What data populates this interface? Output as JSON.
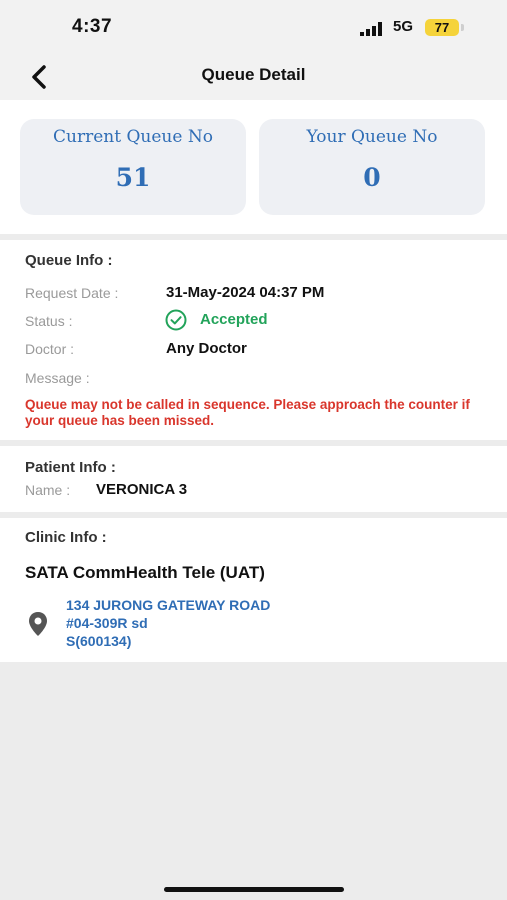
{
  "statusbar": {
    "time": "4:37",
    "network": "5G",
    "battery": "77"
  },
  "nav": {
    "title": "Queue Detail",
    "back_icon": "chevron-left-icon"
  },
  "queue": {
    "current_label": "Current Queue No",
    "current_value": "51",
    "yours_label": "Your Queue No",
    "yours_value": "0"
  },
  "queue_info": {
    "title": "Queue Info :",
    "request_date_label": "Request Date :",
    "request_date_value": "31-May-2024 04:37 PM",
    "status_label": "Status :",
    "status_value": "Accepted",
    "doctor_label": "Doctor :",
    "doctor_value": "Any Doctor",
    "message_label": "Message :",
    "warning": "Queue may not be called in sequence. Please approach the counter if your queue has been missed."
  },
  "patient_info": {
    "title": "Patient Info :",
    "name_label": "Name :",
    "name_value": "VERONICA 3"
  },
  "clinic_info": {
    "title": "Clinic Info :",
    "name": "SATA CommHealth Tele (UAT)",
    "address_line1": "134 JURONG GATEWAY ROAD",
    "address_line2": "#04-309R sd",
    "address_line3": "S(600134)"
  },
  "colors": {
    "accent": "#2f6db5",
    "success": "#22a35a",
    "danger": "#d9362c"
  }
}
